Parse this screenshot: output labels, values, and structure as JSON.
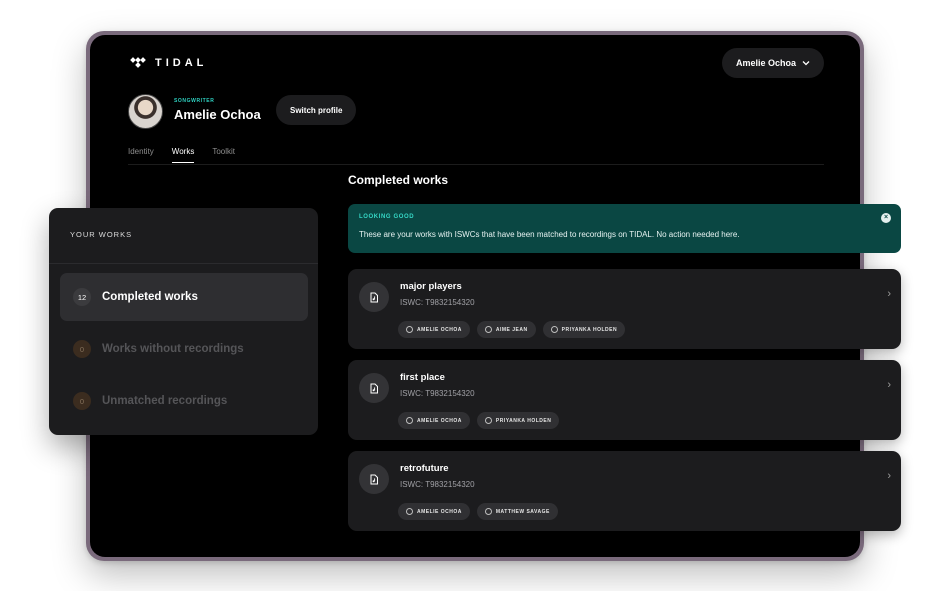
{
  "brand": {
    "logo_text": "TIDAL"
  },
  "header": {
    "user_menu_label": "Amelie Ochoa"
  },
  "profile": {
    "role": "SONGWRITER",
    "name": "Amelie Ochoa",
    "switch_label": "Switch profile"
  },
  "tabs": [
    {
      "label": "Identity",
      "active": false
    },
    {
      "label": "Works",
      "active": true
    },
    {
      "label": "Toolkit",
      "active": false
    }
  ],
  "main": {
    "section_title": "Completed works"
  },
  "banner": {
    "label": "LOOKING GOOD",
    "text": "These are your works with ISWCs that have been matched to recordings on TIDAL.  No action needed here."
  },
  "works": [
    {
      "title": "major players",
      "iswc": "ISWC: T9832154320",
      "contributors": [
        "AMELIE OCHOA",
        "AIME JEAN",
        "PRIYANKA HOLDEN"
      ]
    },
    {
      "title": "first place",
      "iswc": "ISWC: T9832154320",
      "contributors": [
        "AMELIE OCHOA",
        "PRIYANKA HOLDEN"
      ]
    },
    {
      "title": "retrofuture",
      "iswc": "ISWC: T9832154320",
      "contributors": [
        "AMELIE OCHOA",
        "MATTHEW SAVAGE"
      ]
    }
  ],
  "sidebar": {
    "title": "YOUR WORKS",
    "items": [
      {
        "count": "12",
        "label": "Completed works",
        "active": true
      },
      {
        "count": "0",
        "label": "Works without recordings",
        "active": false
      },
      {
        "count": "0",
        "label": "Unmatched recordings",
        "active": false
      }
    ]
  },
  "colors": {
    "accent_teal": "#2ed1c1",
    "banner_bg": "#0a4743",
    "card_bg": "#1c1c1e",
    "device_frame": "#7a6a7c"
  }
}
